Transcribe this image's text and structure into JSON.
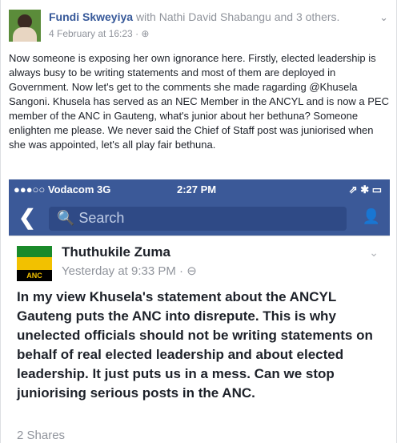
{
  "post": {
    "author": "Fundi Skweyiya",
    "with_text": "with Nathi David Shabangu and 3 others.",
    "timestamp": "4 February at 16:23",
    "privacy_glyph": "·",
    "body": "Now someone is exposing her own ignorance here. Firstly, elected leadership is always busy to be writing statements and most of them are deployed in Government. Now let's get to the comments she made ragarding @Khusela Sangoni. Khusela has served as an NEC Member in the ANCYL and is now a PEC member of the ANC in Gauteng, what's junior about her bethuna? Someone enlighten me please. We never said the Chief of Staff post was juniorised when she was appointed, let's all play fair bethuna."
  },
  "phone": {
    "carrier": "●●●○○ Vodacom  3G",
    "time": "2:27 PM",
    "right_status": "⇗ ✱ ▭",
    "back": "❮",
    "search_placeholder": "🔍 Search",
    "friends_icon": "👤"
  },
  "shared": {
    "author": "Thuthukile Zuma",
    "time": "Yesterday at 9:33 PM · ",
    "logo_text": "ANC",
    "body": "In my view Khusela's statement about the ANCYL Gauteng puts the ANC into disrepute. This is why unelected officials should not be writing statements on behalf of real elected leadership and about elected leadership. It just puts us in a mess. Can we stop juniorising serious posts in the ANC.",
    "shares": "2 Shares"
  },
  "colors": {
    "facebook_blue": "#3b5998",
    "link": "#365899"
  }
}
